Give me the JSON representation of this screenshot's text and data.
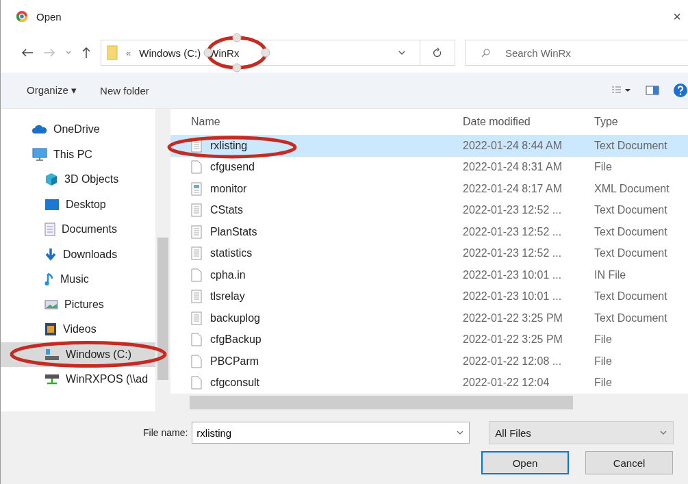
{
  "window": {
    "title": "Open",
    "close": "×"
  },
  "address": {
    "overflow": "«",
    "crumbs": [
      "Windows (C:)",
      "WinRx"
    ],
    "search_placeholder": "Search WinRx"
  },
  "toolbar": {
    "organize": "Organize ▾",
    "new_folder": "New folder"
  },
  "sidebar": {
    "items": [
      {
        "label": "OneDrive",
        "selected": false
      },
      {
        "label": "This PC",
        "selected": false,
        "children": [
          {
            "label": "3D Objects",
            "selected": false
          },
          {
            "label": "Desktop",
            "selected": false
          },
          {
            "label": "Documents",
            "selected": false
          },
          {
            "label": "Downloads",
            "selected": false
          },
          {
            "label": "Music",
            "selected": false
          },
          {
            "label": "Pictures",
            "selected": false
          },
          {
            "label": "Videos",
            "selected": false
          },
          {
            "label": "Windows (C:)",
            "selected": true
          },
          {
            "label": "WinRXPOS (\\\\ad",
            "selected": false
          }
        ]
      }
    ]
  },
  "table": {
    "columns": [
      "Name",
      "Date modified",
      "Type"
    ],
    "rows": [
      {
        "name": "rxlisting",
        "date": "2022-01-24 8:44 AM",
        "type": "Text Document",
        "kind": "text",
        "selected": true
      },
      {
        "name": "cfgusend",
        "date": "2022-01-24 8:31 AM",
        "type": "File",
        "kind": "blank",
        "selected": false
      },
      {
        "name": "monitor",
        "date": "2022-01-24 8:17 AM",
        "type": "XML Document",
        "kind": "xml",
        "selected": false
      },
      {
        "name": "CStats",
        "date": "2022-01-23 12:52 ...",
        "type": "Text Document",
        "kind": "text",
        "selected": false
      },
      {
        "name": "PlanStats",
        "date": "2022-01-23 12:52 ...",
        "type": "Text Document",
        "kind": "text",
        "selected": false
      },
      {
        "name": "statistics",
        "date": "2022-01-23 12:52 ...",
        "type": "Text Document",
        "kind": "text",
        "selected": false
      },
      {
        "name": "cpha.in",
        "date": "2022-01-23 10:01 ...",
        "type": "IN File",
        "kind": "blank",
        "selected": false
      },
      {
        "name": "tlsrelay",
        "date": "2022-01-23 10:01 ...",
        "type": "Text Document",
        "kind": "text",
        "selected": false
      },
      {
        "name": "backuplog",
        "date": "2022-01-22 3:25 PM",
        "type": "Text Document",
        "kind": "text",
        "selected": false
      },
      {
        "name": "cfgBackup",
        "date": "2022-01-22 3:25 PM",
        "type": "File",
        "kind": "blank",
        "selected": false
      },
      {
        "name": "PBCParm",
        "date": "2022-01-22 12:08 ...",
        "type": "File",
        "kind": "blank",
        "selected": false
      },
      {
        "name": "cfgconsult",
        "date": "2022-01-22 12:04",
        "type": "File",
        "kind": "blank",
        "selected": false
      }
    ]
  },
  "footer": {
    "file_name_label": "File name:",
    "file_name": "rxlisting",
    "filter": "All Files",
    "buttons": [
      {
        "label": "Open",
        "kind": "primary"
      },
      {
        "label": "Cancel",
        "kind": "normal"
      }
    ]
  }
}
